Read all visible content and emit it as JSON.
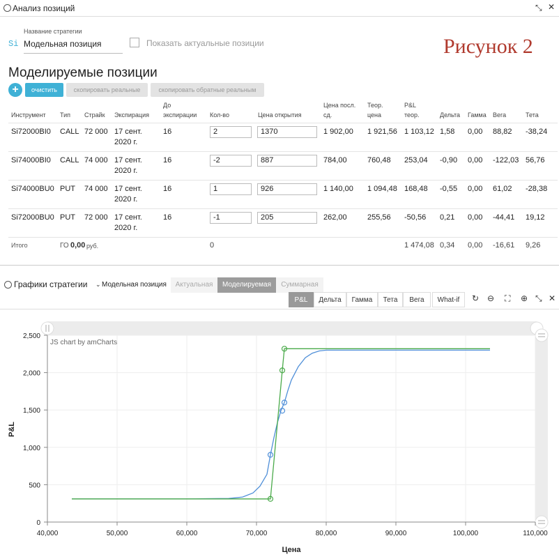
{
  "panel": {
    "title": "Анализ позиций"
  },
  "strategy": {
    "name_label": "Название стратегии",
    "prefix": "Si",
    "name_value": "Модельная позиция",
    "show_actual_label": "Показать актуальные позиции",
    "figure_caption": "Рисунок 2"
  },
  "positions": {
    "title": "Моделируемые позиции",
    "add_label": "+",
    "clear_label": "очистить",
    "copy_real_label": "скопировать реальные",
    "copy_reverse_label": "скопировать обратные реальным",
    "headers": {
      "instrument": "Инструмент",
      "type": "Тип",
      "strike": "Страйк",
      "expiration": "Экспирация",
      "to_exp_1": "До",
      "to_exp_2": "экспирации",
      "qty": "Кол-во",
      "open_price": "Цена открытия",
      "last_price_1": "Цена посл.",
      "last_price_2": "сд.",
      "theor_1": "Теор.",
      "theor_2": "цена",
      "pnl_1": "P&L",
      "pnl_2": "теор.",
      "delta": "Дельта",
      "gamma": "Гамма",
      "vega": "Вега",
      "theta": "Тета"
    },
    "rows": [
      {
        "instrument": "Si72000BI0",
        "type": "CALL",
        "strike": "72 000",
        "exp1": "17 сент.",
        "exp2": "2020 г.",
        "days": "16",
        "qty": "2",
        "open": "1370",
        "last": "1 902,00",
        "theor": "1 921,56",
        "pnl": "1 103,12",
        "delta": "1,58",
        "gamma": "0,00",
        "vega": "88,82",
        "theta": "-38,24"
      },
      {
        "instrument": "Si74000BI0",
        "type": "CALL",
        "strike": "74 000",
        "exp1": "17 сент.",
        "exp2": "2020 г.",
        "days": "16",
        "qty": "-2",
        "open": "887",
        "last": "784,00",
        "theor": "760,48",
        "pnl": "253,04",
        "delta": "-0,90",
        "gamma": "0,00",
        "vega": "-122,03",
        "theta": "56,76"
      },
      {
        "instrument": "Si74000BU0",
        "type": "PUT",
        "strike": "74 000",
        "exp1": "17 сент.",
        "exp2": "2020 г.",
        "days": "16",
        "qty": "1",
        "open": "926",
        "last": "1 140,00",
        "theor": "1 094,48",
        "pnl": "168,48",
        "delta": "-0,55",
        "gamma": "0,00",
        "vega": "61,02",
        "theta": "-28,38"
      },
      {
        "instrument": "Si72000BU0",
        "type": "PUT",
        "strike": "72 000",
        "exp1": "17 сент.",
        "exp2": "2020 г.",
        "days": "16",
        "qty": "-1",
        "open": "205",
        "last": "262,00",
        "theor": "255,56",
        "pnl": "-50,56",
        "delta": "0,21",
        "gamma": "0,00",
        "vega": "-44,41",
        "theta": "19,12"
      }
    ],
    "total": {
      "label": "Итого",
      "go_label": "ГО",
      "go_value": "0,00",
      "go_unit": "руб.",
      "qty": "0",
      "pnl": "1 474,08",
      "delta": "0,34",
      "gamma": "0,00",
      "vega": "-16,61",
      "theta": "9,26"
    }
  },
  "charts_panel": {
    "title": "Графики стратегии",
    "strategy_select": "Модельная позиция",
    "tabs": [
      "Актуальная",
      "Моделируемая",
      "Суммарная"
    ],
    "active_tab": "Моделируемая",
    "chart_buttons": [
      "P&L",
      "Дельта",
      "Гамма",
      "Тета",
      "Вега",
      "What-if"
    ],
    "active_button": "P&L"
  },
  "colors": {
    "accent": "#3fb1d6",
    "blue_series": "#4f8fd8",
    "green_series": "#4aaa4a",
    "caption": "#b03a2e"
  },
  "chart_data": {
    "type": "line",
    "credit": "JS chart by amCharts",
    "xlabel": "Цена",
    "ylabel": "P&L",
    "xlim": [
      40000,
      110000
    ],
    "ylim": [
      0,
      2500
    ],
    "x_ticks": [
      "40,000",
      "50,000",
      "60,000",
      "70,000",
      "80,000",
      "90,000",
      "100,000",
      "110,000"
    ],
    "y_ticks": [
      "0",
      "500",
      "1,000",
      "1,500",
      "2,000",
      "2,500"
    ],
    "series": [
      {
        "color": "#4f8fd8",
        "x": [
          43500,
          60000,
          66000,
          68000,
          69500,
          70500,
          71500,
          72000,
          72500,
          73000,
          73500,
          74000,
          74500,
          75000,
          76000,
          77000,
          78000,
          79000,
          80000,
          85000,
          103500
        ],
        "y": [
          310,
          310,
          315,
          335,
          390,
          480,
          640,
          900,
          1130,
          1330,
          1490,
          1600,
          1760,
          1900,
          2080,
          2200,
          2260,
          2290,
          2300,
          2300,
          2300
        ],
        "markers_x": [
          72000,
          73700,
          74000
        ],
        "markers_y": [
          900,
          1490,
          1600
        ]
      },
      {
        "color": "#4aaa4a",
        "x": [
          43500,
          72000,
          73700,
          74000,
          103500
        ],
        "y": [
          310,
          310,
          2030,
          2320,
          2320
        ],
        "markers_x": [
          72000,
          73700,
          74000
        ],
        "markers_y": [
          310,
          2030,
          2320
        ]
      }
    ]
  }
}
